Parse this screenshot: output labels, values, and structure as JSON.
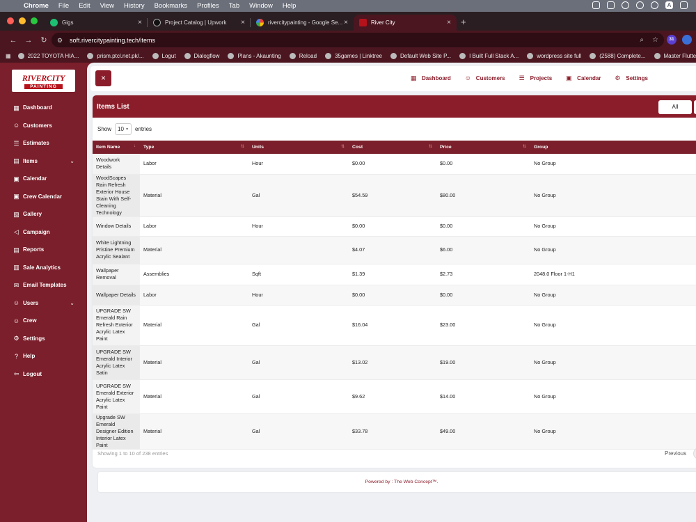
{
  "menubar": {
    "app": "Chrome",
    "items": [
      "File",
      "Edit",
      "View",
      "History",
      "Bookmarks",
      "Profiles",
      "Tab",
      "Window",
      "Help"
    ]
  },
  "tabs": [
    {
      "label": "Gigs",
      "color": "#1dbf73",
      "active": false
    },
    {
      "label": "Project Catalog | Upwork",
      "color": "#333333",
      "active": false
    },
    {
      "label": "rivercitypainting - Google Se...",
      "color": "#4285f4",
      "active": false
    },
    {
      "label": "River City",
      "color": "#b5121b",
      "active": true
    }
  ],
  "address": {
    "url": "soft.rivercitypainting.tech/items"
  },
  "extensions": [
    "31"
  ],
  "bookmarks": [
    "2022 TOYOTA HIA...",
    "prism.ptcl.net.pk/...",
    "Logut",
    "Dialogflow",
    "Plans - Akaunting",
    "Reload",
    "35games | Linktree",
    "Default Web Site P...",
    "I Built Full Stack A...",
    "wordpress site full",
    "(2588) Complete...",
    "Master Flutter"
  ],
  "logo": {
    "line1": "RIVERCITY",
    "line2": "PAINTING"
  },
  "sidebar": {
    "items": [
      {
        "label": "Dashboard",
        "icon": "dashboard-icon"
      },
      {
        "label": "Customers",
        "icon": "users-icon"
      },
      {
        "label": "Estimates",
        "icon": "list-icon"
      },
      {
        "label": "Items",
        "icon": "items-icon",
        "expandable": true
      },
      {
        "label": "Calendar",
        "icon": "calendar-icon"
      },
      {
        "label": "Crew Calendar",
        "icon": "calendar-icon"
      },
      {
        "label": "Gallery",
        "icon": "image-icon"
      },
      {
        "label": "Campaign",
        "icon": "megaphone-icon"
      },
      {
        "label": "Reports",
        "icon": "report-icon"
      },
      {
        "label": "Sale Analytics",
        "icon": "analytics-icon"
      },
      {
        "label": "Email Templates",
        "icon": "email-icon"
      },
      {
        "label": "Users",
        "icon": "users-icon",
        "expandable": true
      },
      {
        "label": "Crew",
        "icon": "crew-icon"
      },
      {
        "label": "Settings",
        "icon": "gear-icon"
      },
      {
        "label": "Help",
        "icon": "help-icon"
      },
      {
        "label": "Logout",
        "icon": "logout-icon"
      }
    ]
  },
  "topnav": {
    "close": "×",
    "links": [
      {
        "label": "Dashboard",
        "icon": "dashboard-icon"
      },
      {
        "label": "Customers",
        "icon": "users-icon"
      },
      {
        "label": "Projects",
        "icon": "list-icon"
      },
      {
        "label": "Calendar",
        "icon": "calendar-icon"
      },
      {
        "label": "Settings",
        "icon": "gear-icon"
      }
    ]
  },
  "card": {
    "title": "Items List",
    "filter_all": "All",
    "show_label": "Show",
    "show_value": "10",
    "entries_label": "entries"
  },
  "table": {
    "columns": [
      "Item Name",
      "Type",
      "Units",
      "Cost",
      "Price",
      "Group"
    ],
    "rows": [
      [
        "Woodwork Details",
        "Labor",
        "Hour",
        "$0.00",
        "$0.00",
        "No Group"
      ],
      [
        "WoodScapes Rain Refresh Exterior House Stain With Self-Cleaning Technology",
        "Material",
        "Gal",
        "$54.59",
        "$80.00",
        "No Group"
      ],
      [
        "Window Details",
        "Labor",
        "Hour",
        "$0.00",
        "$0.00",
        "No Group"
      ],
      [
        "White Lightning Pristine Premium Acrylic Sealant",
        "Material",
        "",
        "$4.07",
        "$6.00",
        "No Group"
      ],
      [
        "Wallpaper Removal",
        "Assemblies",
        "Sqft",
        "$1.39",
        "$2.73",
        "2048.0 Floor 1-H1"
      ],
      [
        "Wallpaper Details",
        "Labor",
        "Hour",
        "$0.00",
        "$0.00",
        "No Group"
      ],
      [
        "UPGRADE SW Emerald Rain Refresh Exterior Acrylic Latex Paint",
        "Material",
        "Gal",
        "$16.04",
        "$23.00",
        "No Group"
      ],
      [
        "UPGRADE SW Emerald Interior Acrylic Latex Satin",
        "Material",
        "Gal",
        "$13.02",
        "$19.00",
        "No Group"
      ],
      [
        "UPGRADE SW Emerald Exterior Acrylic Latex Paint",
        "Material",
        "Gal",
        "$9.62",
        "$14.00",
        "No Group"
      ],
      [
        "Upgrade SW Emerald Designer Edition Interior Latex Paint",
        "Material",
        "Gal",
        "$33.78",
        "$49.00",
        "No Group"
      ]
    ]
  },
  "footer": {
    "info": "Showing 1 to 10 of 238 entries",
    "previous": "Previous",
    "powered": "Powered by : The Web Concept™."
  },
  "colors": {
    "brand": "#8b1c2a",
    "sidebar": "#7a1f2b"
  }
}
